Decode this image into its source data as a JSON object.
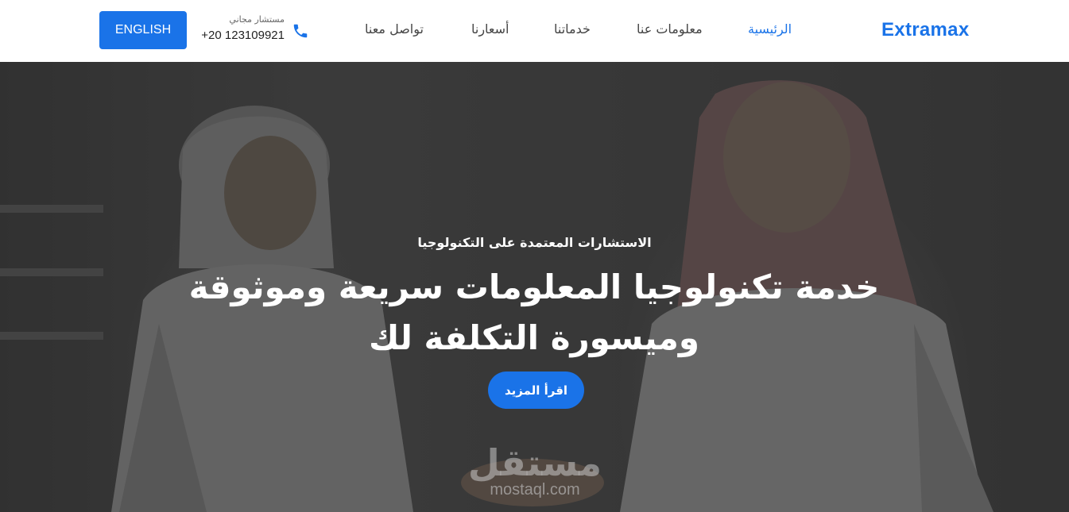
{
  "header": {
    "brand": "Extramax",
    "nav": [
      {
        "label": "الرئيسية",
        "active": true
      },
      {
        "label": "معلومات عنا",
        "active": false
      },
      {
        "label": "خدماتنا",
        "active": false
      },
      {
        "label": "أسعارنا",
        "active": false
      },
      {
        "label": "تواصل معنا",
        "active": false
      }
    ],
    "phone_label": "مستشار مجاني",
    "phone_number": "+20 123109921",
    "phone_icon": "phone-icon",
    "lang_button": "ENGLISH"
  },
  "hero": {
    "subtitle": "الاستشارات المعتمدة على التكنولوجيا",
    "title_line1": "خدمة تكنولوجيا المعلومات سريعة وموثوقة",
    "title_line2": "وميسورة التكلفة لك",
    "cta": "اقرأ المزيد"
  },
  "watermark": {
    "arabic": "مستقل",
    "latin": "mostaql.com"
  },
  "colors": {
    "accent": "#1a73e8",
    "nav_text": "#444444"
  }
}
